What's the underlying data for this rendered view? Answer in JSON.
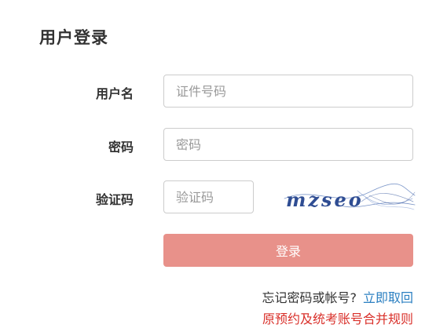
{
  "page": {
    "title": "用户登录"
  },
  "form": {
    "username_label": "用户名",
    "username_placeholder": "证件号码",
    "password_label": "密码",
    "password_placeholder": "密码",
    "captcha_label": "验证码",
    "captcha_placeholder": "验证码",
    "captcha_text": "mzseo",
    "login_button": "登录",
    "login_button_color": "#e8918a"
  },
  "links": {
    "forgot_text": "忘记密码或帐号?",
    "recover_link": "立即取回",
    "merge_link": "原预约及统考账号合并规则",
    "link_color": "#2a7fc1",
    "merge_color": "#d9302a"
  }
}
